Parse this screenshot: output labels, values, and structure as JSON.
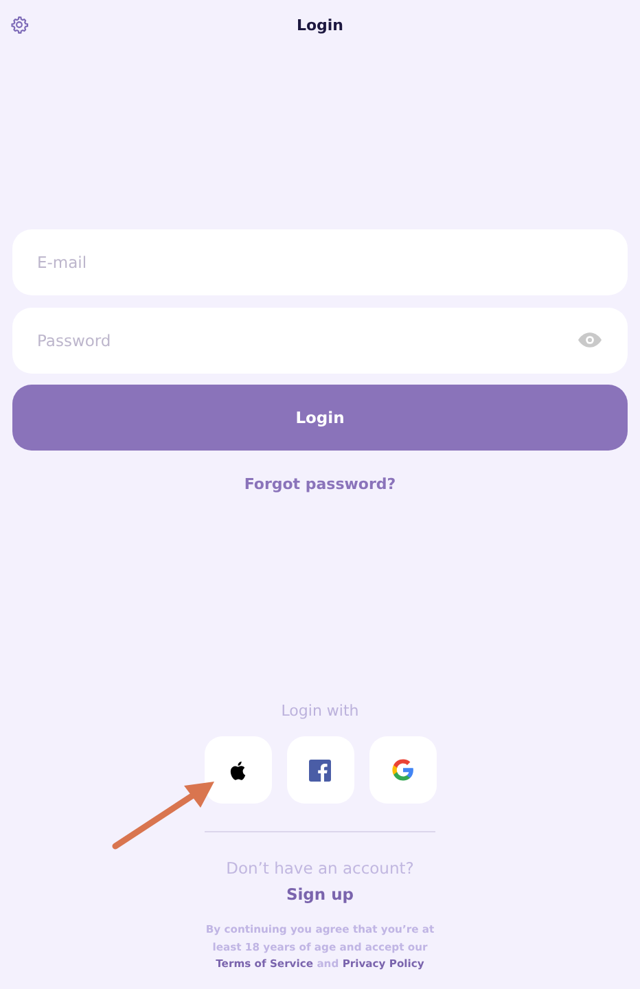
{
  "header": {
    "title": "Login"
  },
  "form": {
    "email": {
      "placeholder": "E-mail"
    },
    "password": {
      "placeholder": "Password"
    },
    "submit": "Login",
    "forgot": "Forgot password?"
  },
  "social": {
    "label": "Login with",
    "providers": [
      {
        "kind": "apple"
      },
      {
        "kind": "facebook"
      },
      {
        "kind": "google"
      }
    ]
  },
  "signup": {
    "prompt": "Don’t have an account?",
    "link": "Sign up"
  },
  "consent": {
    "text": "By continuing you agree that you’re at least 18 years of age and accept our",
    "terms": "Terms of Service",
    "joiner": "and",
    "privacy": "Privacy Policy"
  }
}
